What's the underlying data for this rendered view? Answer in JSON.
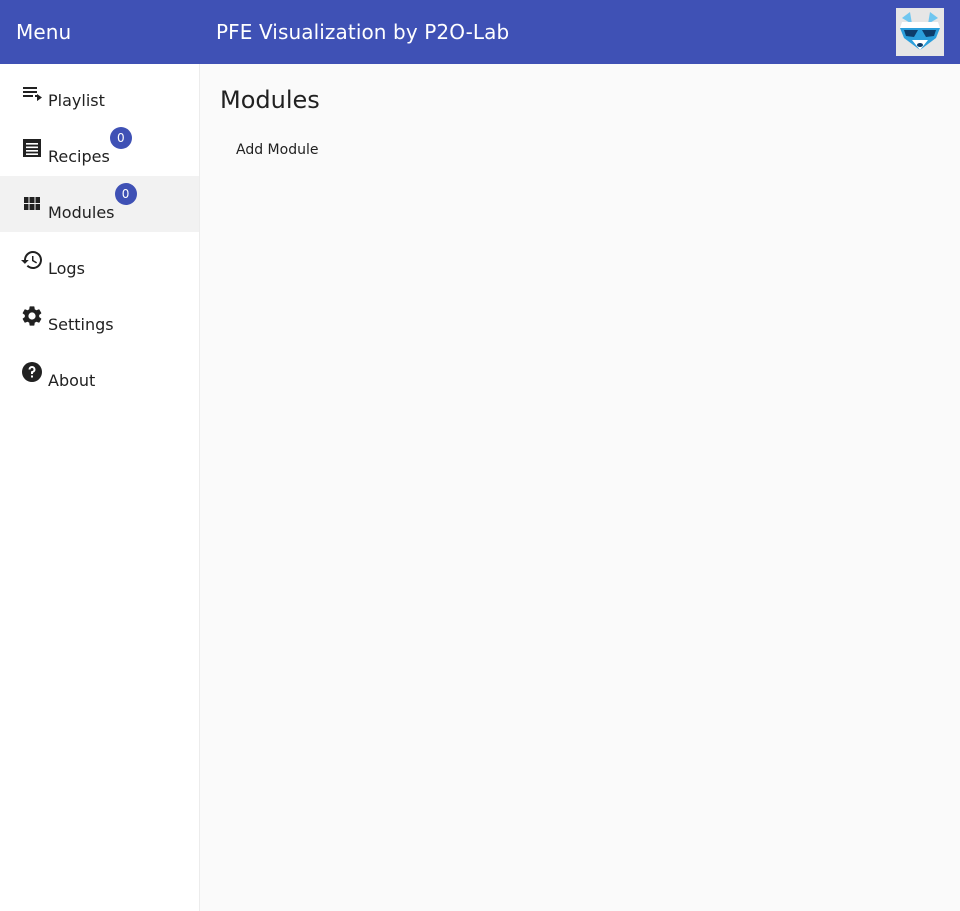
{
  "toolbar": {
    "menu_title": "Menu",
    "app_title": "PFE Visualization by P2O-Lab",
    "logo_icon": "raccoon-logo-icon",
    "color": "#3f51b5"
  },
  "sidebar": {
    "items": [
      {
        "label": "Playlist",
        "icon": "playlist-icon"
      },
      {
        "label": "Recipes",
        "icon": "recipes-icon",
        "badge": "0"
      },
      {
        "label": "Modules",
        "icon": "modules-icon",
        "badge": "0",
        "active": true
      },
      {
        "label": "Logs",
        "icon": "history-icon"
      },
      {
        "label": "Settings",
        "icon": "gear-icon"
      },
      {
        "label": "About",
        "icon": "help-icon"
      }
    ]
  },
  "main": {
    "title": "Modules",
    "add_button_label": "Add Module"
  }
}
